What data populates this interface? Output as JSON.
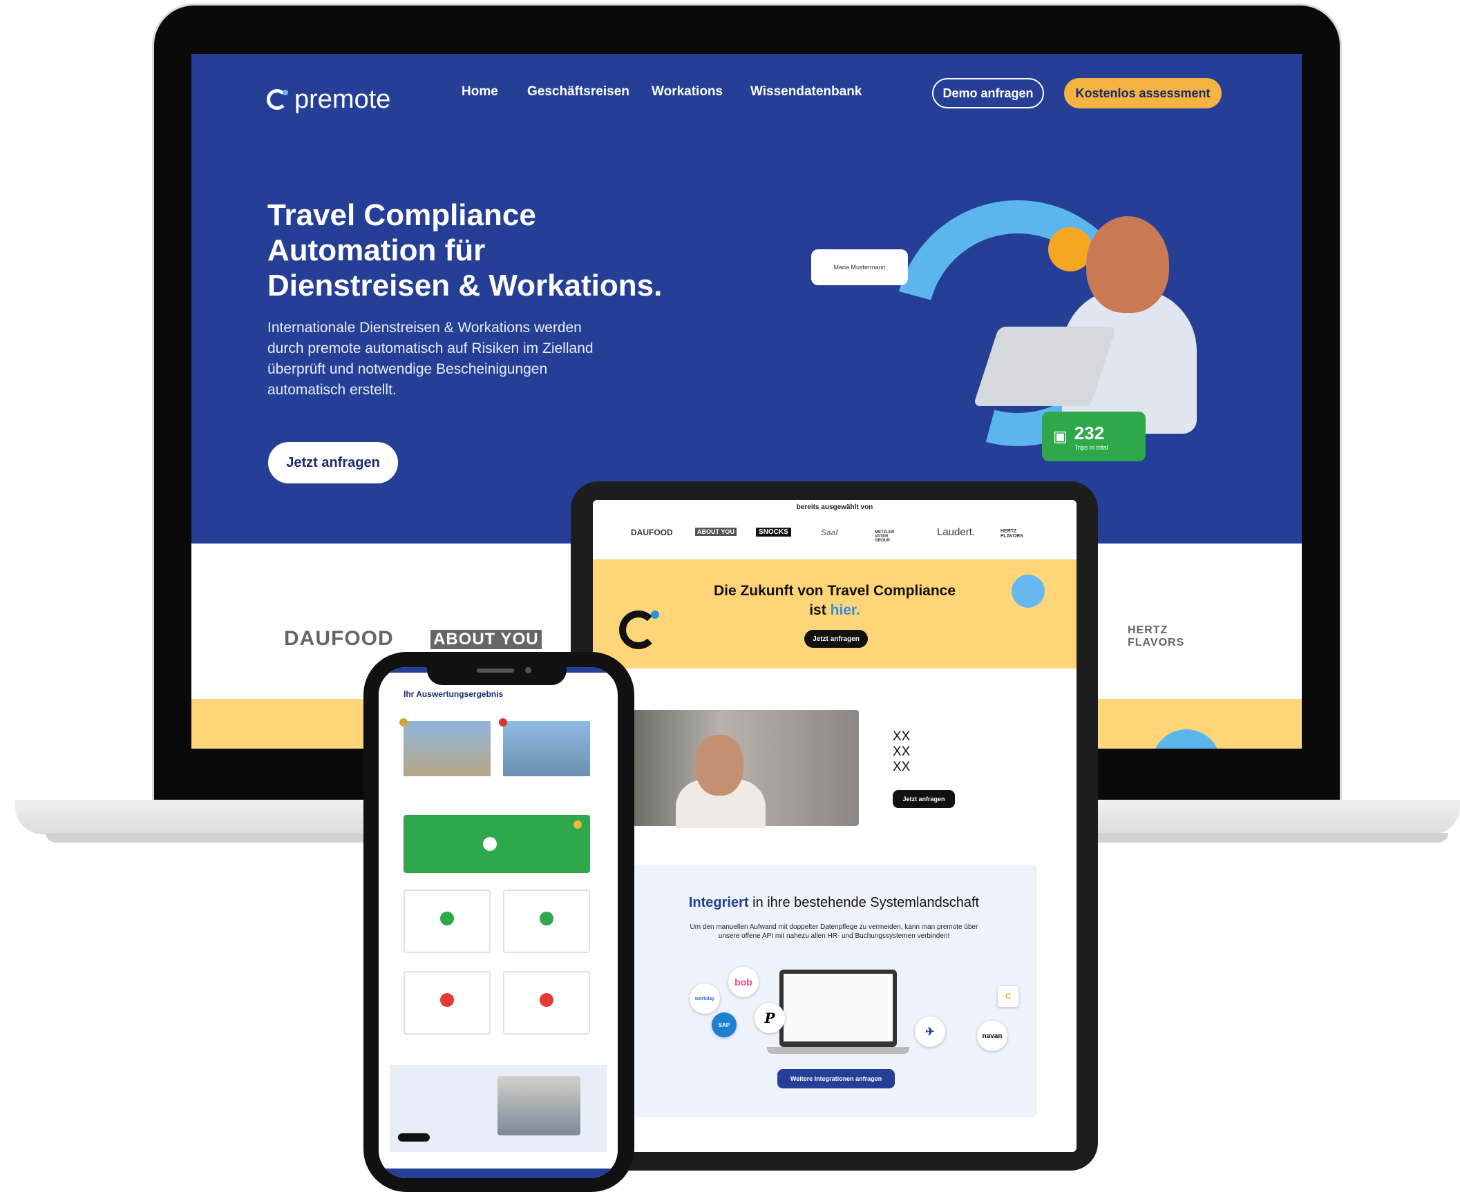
{
  "laptop": {
    "brand": "premote",
    "nav": [
      "Home",
      "Geschäftsreisen",
      "Workations",
      "Wissendatenbank"
    ],
    "btn_demo": "Demo anfragen",
    "btn_assessment": "Kostenlos assessment",
    "hero_title_lines": [
      "Travel Compliance",
      "Automation für",
      "Dienstreisen & Workations."
    ],
    "hero_text": "Internationale Dienstreisen & Workations werden durch premote automatisch auf Risiken im Zielland überprüft und notwendige Bescheinigungen automatisch erstellt.",
    "hero_cta": "Jetzt anfragen",
    "name_card": "Maria Mustermann",
    "stat_value": "232",
    "stat_label": "Trips in total",
    "logos": [
      "DAUFOOD",
      "ABOUT YOU",
      "HERTZ FLAVORS"
    ]
  },
  "tablet": {
    "selected_by": "bereits ausgewählt von",
    "logos": [
      "DAUFOOD",
      "ABOUT YOU",
      "SNOCKS",
      "Saal",
      "METZLER VATER GROUP",
      "Laudert.",
      "HERTZ FLAVORS"
    ],
    "headline_part1": "Die Zukunft von Travel Compliance",
    "headline_part2": "ist",
    "headline_highlight": "hier.",
    "cta": "Jetzt anfragen",
    "video_lines": [
      "XX",
      "XX",
      "XX"
    ],
    "video_cta": "Jetzt anfragen",
    "integration_highlight": "Integriert",
    "integration_title": " in ihre bestehende Systemlandschaft",
    "integration_text": "Um den manuellen Aufwand mit doppelter Datenpflege zu vermeiden, kann man premote über unsere offene API mit nahezu allen HR- und Buchungssystemen verbinden!",
    "integration_tools": [
      "workday",
      "bob",
      "SAP",
      "P",
      "navan",
      "C"
    ],
    "integration_cta": "Weitere Integrationen anfragen"
  },
  "phone": {
    "title": "Ihr Auswertungsergebnis"
  },
  "colors": {
    "primary_blue": "#263f96",
    "accent_yellow": "#ffd57a",
    "accent_orange": "#f5b342",
    "light_blue": "#5cb6ee",
    "success_green": "#2ea84a",
    "alert_red": "#e53935"
  }
}
